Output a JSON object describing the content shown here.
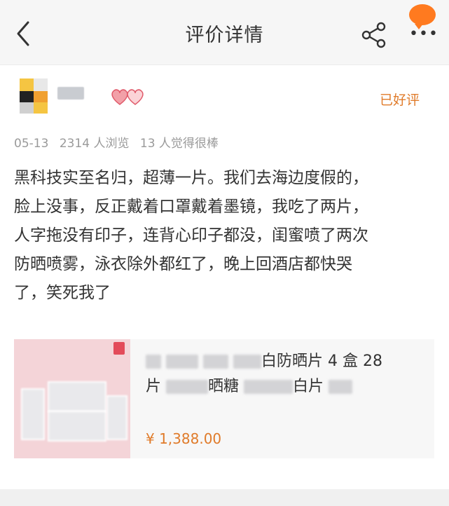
{
  "navbar": {
    "title": "评价详情",
    "back_icon": "chevron-left-icon",
    "share_icon": "share-icon",
    "more_icon": "more-icon"
  },
  "reviewer": {
    "badge": "已好评",
    "hearts_icon": "hearts-icon"
  },
  "meta": {
    "date": "05-13",
    "views": "2314 人浏览",
    "likes": "13 人觉得很棒"
  },
  "review": {
    "lines": [
      "黑科技实至名归，超薄一片。我们去海边度假的，",
      "脸上没事，反正戴着口罩戴着墨镜，我吃了两片，",
      "人字拖没有印子，连背心印子都没，闺蜜喷了两次",
      "防晒喷雾，泳衣除外都红了，晚上回酒店都快哭",
      "了，笑死我了"
    ]
  },
  "product": {
    "title_part1": "白防晒片 4 盒 28",
    "title_part2": "片",
    "title_part3": "晒糖",
    "title_part4": "白片",
    "price": "¥ 1,388.00"
  },
  "colors": {
    "accent": "#e07b2a",
    "nav_bg": "#f6f6f6",
    "notify": "#ff7a1f"
  }
}
